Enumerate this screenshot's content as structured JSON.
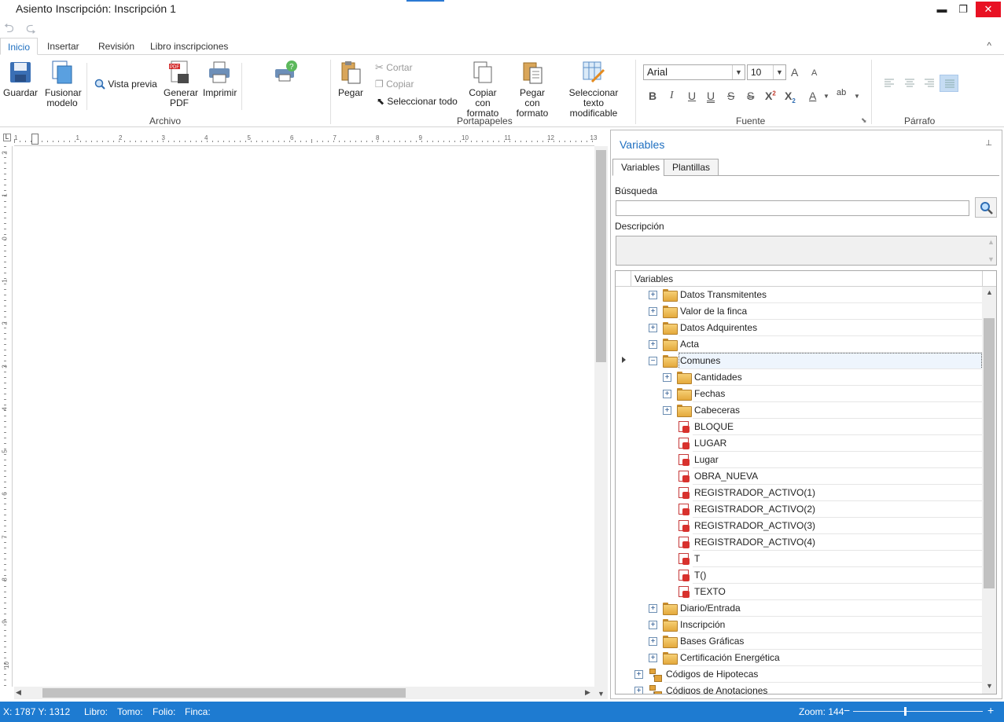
{
  "window": {
    "title": "Asiento Inscripción: Inscripción 1",
    "minimize": "▬",
    "restore": "❐",
    "close": "✕"
  },
  "quick_access": {
    "undo": "⮌",
    "redo": "⮎"
  },
  "ribbon": {
    "tabs": [
      "Inicio",
      "Insertar",
      "Revisión",
      "Libro inscripciones"
    ],
    "active_tab": "Inicio",
    "collapse_icon": "^",
    "archivo": {
      "group_label": "Archivo",
      "guardar": "Guardar",
      "fusionar": "Fusionar modelo",
      "vista_previa": "Vista previa",
      "generar_pdf": "Generar PDF",
      "imprimir": "Imprimir"
    },
    "portapapeles": {
      "group_label": "Portapapeles",
      "pegar": "Pegar",
      "cortar": "Cortar",
      "copiar": "Copiar",
      "seleccionar_todo": "Seleccionar todo",
      "copiar_formato": "Copiar con formato",
      "pegar_formato": "Pegar con formato",
      "seleccionar_texto": "Seleccionar texto modificable"
    },
    "fuente": {
      "group_label": "Fuente",
      "font_name": "Arial",
      "font_size": "10",
      "grow": "A",
      "shrink": "A",
      "bold": "B",
      "italic": "I",
      "underline": "U",
      "double_underline": "U",
      "strike": "S",
      "double_strike": "S",
      "superscript": "X",
      "superscript_mark": "2",
      "subscript": "X",
      "subscript_mark": "2",
      "font_color": "A",
      "highlight": "ab"
    },
    "parrafo": {
      "group_label": "Párrafo"
    }
  },
  "ruler": {
    "h_numbers": [
      "1",
      "1",
      "2",
      "3",
      "4",
      "5",
      "6",
      "7",
      "8",
      "9",
      "10",
      "11",
      "12",
      "13"
    ],
    "v_numbers": [
      "2",
      "1",
      "0",
      "1",
      "2",
      "3",
      "4",
      "5",
      "6",
      "7",
      "8",
      "9",
      "10"
    ]
  },
  "panel": {
    "title": "Variables",
    "pin": "📌",
    "tabs": [
      "Variables",
      "Plantillas"
    ],
    "search_label": "Búsqueda",
    "search_value": "",
    "description_label": "Descripción",
    "tree_header": "Variables",
    "tree": [
      {
        "label": "Datos Transmitentes",
        "type": "folder",
        "level": 1,
        "exp": "+"
      },
      {
        "label": "Valor de la finca",
        "type": "folder",
        "level": 1,
        "exp": "+"
      },
      {
        "label": "Datos Adquirentes",
        "type": "folder",
        "level": 1,
        "exp": "+"
      },
      {
        "label": "Acta",
        "type": "folder",
        "level": 1,
        "exp": "+"
      },
      {
        "label": "Comunes",
        "type": "folder",
        "level": 1,
        "exp": "−",
        "selected": true
      },
      {
        "label": "Cantidades",
        "type": "folder",
        "level": 2,
        "exp": "+"
      },
      {
        "label": "Fechas",
        "type": "folder",
        "level": 2,
        "exp": "+"
      },
      {
        "label": "Cabeceras",
        "type": "folder",
        "level": 2,
        "exp": "+"
      },
      {
        "label": "BLOQUE",
        "type": "var",
        "level": 2
      },
      {
        "label": "LUGAR",
        "type": "var",
        "level": 2
      },
      {
        "label": "Lugar",
        "type": "var",
        "level": 2
      },
      {
        "label": "OBRA_NUEVA",
        "type": "var",
        "level": 2
      },
      {
        "label": "REGISTRADOR_ACTIVO(1)",
        "type": "var",
        "level": 2
      },
      {
        "label": "REGISTRADOR_ACTIVO(2)",
        "type": "var",
        "level": 2
      },
      {
        "label": "REGISTRADOR_ACTIVO(3)",
        "type": "var",
        "level": 2
      },
      {
        "label": "REGISTRADOR_ACTIVO(4)",
        "type": "var",
        "level": 2
      },
      {
        "label": "T",
        "type": "var",
        "level": 2
      },
      {
        "label": "T()",
        "type": "var",
        "level": 2
      },
      {
        "label": "TEXTO",
        "type": "var",
        "level": 2
      },
      {
        "label": "Diario/Entrada",
        "type": "folder",
        "level": 1,
        "exp": "+"
      },
      {
        "label": "Inscripción",
        "type": "folder",
        "level": 1,
        "exp": "+"
      },
      {
        "label": "Bases Gráficas",
        "type": "folder",
        "level": 1,
        "exp": "+"
      },
      {
        "label": "Certificación Energética",
        "type": "folder",
        "level": 1,
        "exp": "+"
      },
      {
        "label": "Códigos de Hipotecas",
        "type": "group",
        "level": 0,
        "exp": "+"
      },
      {
        "label": "Códigos de Anotaciones",
        "type": "group",
        "level": 0,
        "exp": "+"
      }
    ]
  },
  "status": {
    "coords": "X: 1787 Y: 1312",
    "libro": "Libro:",
    "tomo": "Tomo:",
    "folio": "Folio:",
    "finca": "Finca:",
    "zoom": "Zoom: 144",
    "zoom_out": "−",
    "zoom_in": "+"
  }
}
